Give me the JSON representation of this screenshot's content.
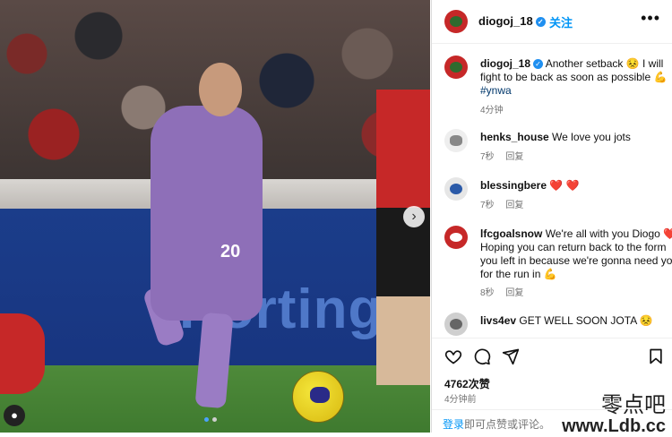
{
  "post": {
    "username": "diogoj_18",
    "verified_mark": "✓",
    "follow_label": "关注",
    "more_label": "•••",
    "caption_text": "Another setback 😣 I will fight to be back as soon as possible 💪 ",
    "caption_hashtag": "#ynwa",
    "caption_time": "4分钟",
    "likes": "4762次赞",
    "time_ago": "4分钟前",
    "login_link": "登录",
    "login_rest": "即可点赞或评论。"
  },
  "photo": {
    "board_text": "Hortings",
    "player_number": "20",
    "next_arrow": "›",
    "user_tag_icon": "user-tag-icon"
  },
  "comments": [
    {
      "user": "henks_house",
      "text": "We love you jots",
      "time": "7秒",
      "reply": "回复"
    },
    {
      "user": "blessingbere",
      "text": "❤️ ❤️",
      "time": "7秒",
      "reply": "回复"
    },
    {
      "user": "lfcgoalsnow",
      "text": "We're all with you Diogo ❤️ Hoping you can return back to the form you left in because we're gonna need you for the run in 💪",
      "time": "8秒",
      "reply": "回复"
    },
    {
      "user": "livs4ev",
      "text": "GET WELL SOON JOTA 😣"
    }
  ],
  "watermark": {
    "line1": "零点吧",
    "line2": "www.Ldb.cc"
  },
  "colors": {
    "accent": "#0095f6",
    "liverpool_purple": "#8e6fb8"
  }
}
